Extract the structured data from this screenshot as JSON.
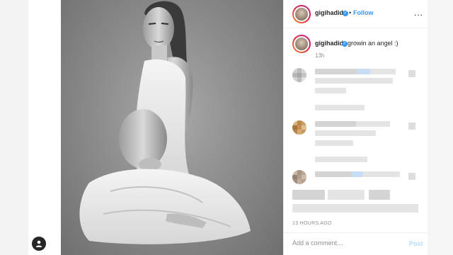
{
  "post": {
    "username": "gigihadid",
    "follow_label": "Follow",
    "separator": "•",
    "more_label": "...",
    "caption": "growin an angel :)",
    "caption_time": "13h",
    "time_ago": "13 HOURS AGO"
  },
  "comment_box": {
    "placeholder": "Add a comment…",
    "post_label": "Post"
  },
  "colors": {
    "accent": "#3897f0",
    "post_disabled": "#b3dbff",
    "text_primary": "#262626",
    "text_secondary": "#8e8e8e"
  },
  "icons": {
    "verified": "verified-badge-icon",
    "more": "more-options-icon",
    "user_tag": "user-tag-icon"
  }
}
